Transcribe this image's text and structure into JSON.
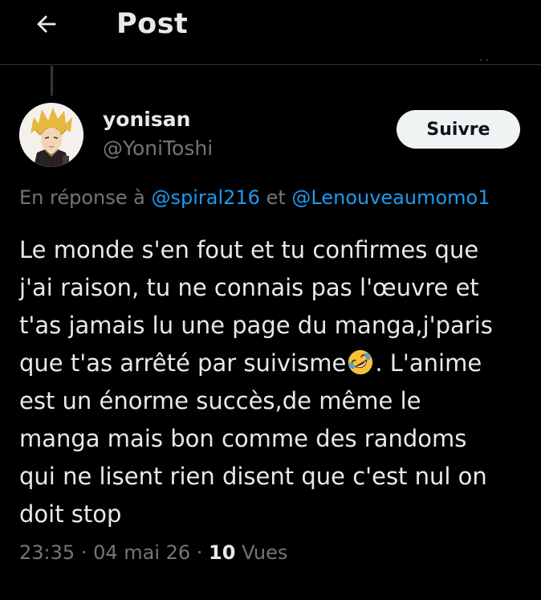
{
  "header": {
    "title": "Post",
    "back_icon": "arrow-left-icon"
  },
  "author": {
    "display_name": "yonisan",
    "handle": "@YoniToshi",
    "follow_label": "Suivre"
  },
  "reply_context": {
    "prefix": "En réponse à ",
    "mention_1": "@spiral216",
    "conjunction": " et ",
    "mention_2": "@Lenouveaumomo1"
  },
  "tweet": {
    "text_before_emoji": "Le monde s'en fout et tu confirmes que\nj'ai raison, tu ne connais pas l'œuvre et\nt'as jamais lu une page du manga,j'paris\nque t'as arrêté par suivisme",
    "emoji_icon": "rolling-on-floor-laughing-emoji",
    "text_after_emoji": ". L'anime\nest un énorme succès,de même le\nmanga mais bon comme des randoms\nqui ne lisent rien disent que c'est nul on\ndoit stop"
  },
  "meta": {
    "time": "23:35",
    "separator": " · ",
    "date": "04 mai 26",
    "views_count": "10",
    "views_label": " Vues"
  },
  "colors": {
    "background": "#000000",
    "text": "#e7e9ea",
    "secondary": "#71767b",
    "link": "#1d9bf0",
    "button_bg": "#eff3f4"
  }
}
